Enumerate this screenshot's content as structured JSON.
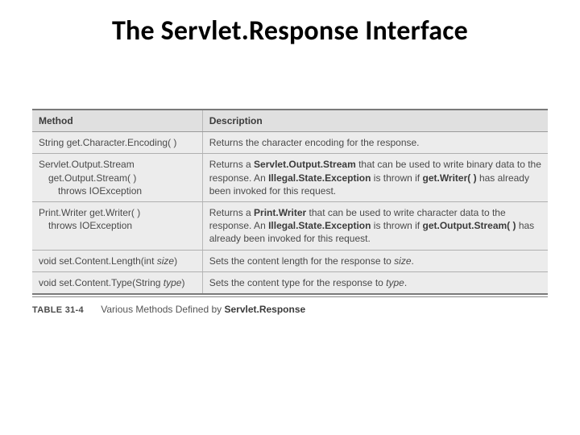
{
  "title": "The Servlet.Response Interface",
  "table": {
    "headers": {
      "method": "Method",
      "description": "Description"
    },
    "rows": [
      {
        "method_l1": "String get.Character.Encoding( )",
        "method_l2": "",
        "method_l3": "",
        "desc_prefix": "Returns the character encoding for the response.",
        "desc_b1": "",
        "desc_mid1": "",
        "desc_b2": "",
        "desc_mid2": "",
        "desc_b3": "",
        "desc_tail": ""
      },
      {
        "method_l1": "Servlet.Output.Stream",
        "method_l2": "get.Output.Stream( )",
        "method_l3": "throws IOException",
        "desc_prefix": "Returns a ",
        "desc_b1": "Servlet.Output.Stream",
        "desc_mid1": " that can be used to write binary data to the response. An ",
        "desc_b2": "Illegal.State.Exception",
        "desc_mid2": " is thrown if ",
        "desc_b3": "get.Writer( )",
        "desc_tail": " has already been invoked for this request."
      },
      {
        "method_l1": "Print.Writer get.Writer( )",
        "method_l2": "throws IOException",
        "method_l3": "",
        "desc_prefix": "Returns a ",
        "desc_b1": "Print.Writer",
        "desc_mid1": " that can be used to write character data to the response. An ",
        "desc_b2": "Illegal.State.Exception",
        "desc_mid2": " is thrown if ",
        "desc_b3": "get.Output.Stream( )",
        "desc_tail": " has already been invoked for this request."
      },
      {
        "method_l1_pre": "void set.Content.Length(int ",
        "method_param": "size",
        "method_l1_post": ")",
        "method_l2": "",
        "method_l3": "",
        "desc_prefix": "Sets the content length for the response to ",
        "desc_it": "size",
        "desc_tail2": "."
      },
      {
        "method_l1_pre": "void set.Content.Type(String ",
        "method_param": "type",
        "method_l1_post": ")",
        "method_l2": "",
        "method_l3": "",
        "desc_prefix": "Sets the content type for the response to ",
        "desc_it": "type",
        "desc_tail2": "."
      }
    ]
  },
  "caption": {
    "label": "Table 31-4",
    "text_pre": "Various Methods Defined by ",
    "text_b": "Servlet.Response"
  }
}
